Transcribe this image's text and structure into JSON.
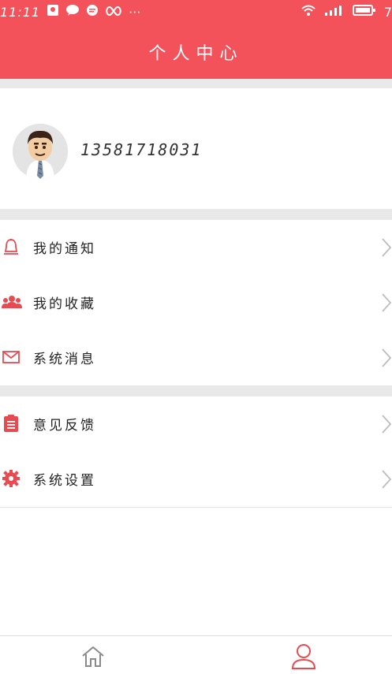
{
  "status_bar": {
    "time": "11:11",
    "icons_left": [
      "notification-icon",
      "chat-icon",
      "message-icon",
      "infinity-icon",
      "more-dots-icon"
    ],
    "icons_right": [
      "wifi-icon",
      "signal-icon",
      "battery-icon"
    ],
    "more": "···",
    "battery_tail": "7"
  },
  "header": {
    "title": "个人中心",
    "bg_color": "#f4525a"
  },
  "profile": {
    "phone": "13581718031",
    "avatar_icon": "user-avatar"
  },
  "menu_group_1": [
    {
      "label": "我的通知",
      "icon": "bell-icon"
    },
    {
      "label": "我的收藏",
      "icon": "users-icon"
    },
    {
      "label": "系统消息",
      "icon": "mail-icon"
    }
  ],
  "menu_group_2": [
    {
      "label": "意见反馈",
      "icon": "clipboard-icon"
    },
    {
      "label": "系统设置",
      "icon": "settings-icon"
    }
  ],
  "bottom_nav": [
    {
      "name": "home",
      "icon": "home-icon"
    },
    {
      "name": "me",
      "icon": "person-icon",
      "active": true
    }
  ],
  "accent_color": "#e84a52"
}
